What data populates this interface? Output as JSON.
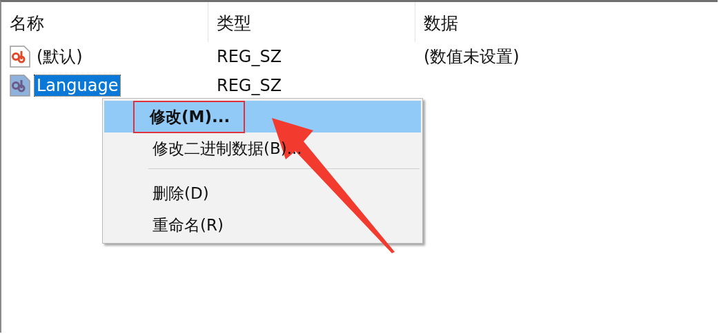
{
  "columns": [
    "名称",
    "类型",
    "数据"
  ],
  "rows": [
    {
      "name": "(默认)",
      "type": "REG_SZ",
      "data": "(数值未设置)",
      "kind": "default",
      "selected": false
    },
    {
      "name": "Language",
      "type": "REG_SZ",
      "data": "",
      "kind": "plain",
      "selected": true
    }
  ],
  "context_menu": {
    "items": [
      {
        "kind": "item",
        "label": "修改(M)...",
        "selected": true,
        "bold": true,
        "marked": true
      },
      {
        "kind": "item",
        "label": "修改二进制数据(B)...",
        "selected": false,
        "bold": false,
        "marked": false
      },
      {
        "kind": "separator"
      },
      {
        "kind": "item",
        "label": "删除(D)",
        "selected": false,
        "bold": false,
        "marked": false
      },
      {
        "kind": "item",
        "label": "重命名(R)",
        "selected": false,
        "bold": false,
        "marked": false
      }
    ]
  }
}
